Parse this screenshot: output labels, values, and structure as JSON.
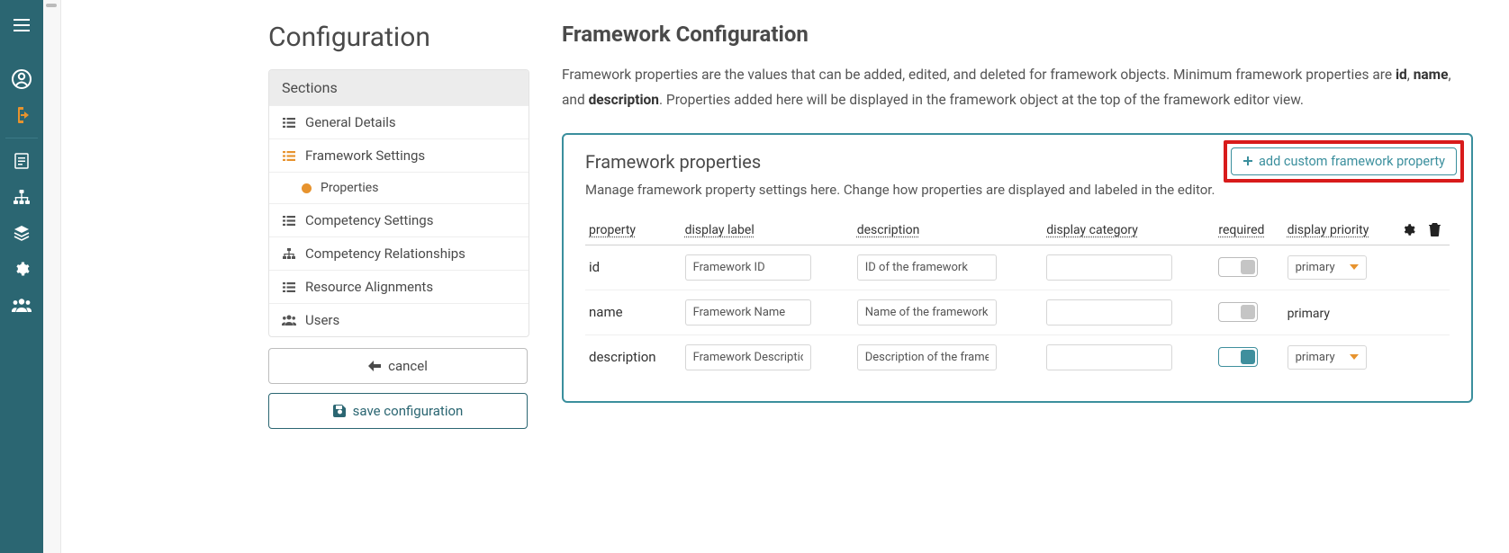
{
  "pageTitle": "Configuration",
  "sections": {
    "header": "Sections",
    "items": [
      {
        "icon": "list",
        "label": "General Details"
      },
      {
        "icon": "list",
        "label": "Framework Settings",
        "orange": true
      },
      {
        "dot": true,
        "label": "Properties",
        "sub": true
      },
      {
        "icon": "list",
        "label": "Competency Settings"
      },
      {
        "icon": "sitemap",
        "label": "Competency Relationships"
      },
      {
        "icon": "list",
        "label": "Resource Alignments"
      },
      {
        "icon": "users",
        "label": "Users"
      }
    ]
  },
  "buttons": {
    "cancel": "cancel",
    "save": "save configuration"
  },
  "right": {
    "title": "Framework Configuration",
    "desc_pre": "Framework properties are the values that can be added, edited, and deleted for framework objects. Minimum framework properties are ",
    "b1": "id",
    "c1": ", ",
    "b2": "name",
    "c2": ", and ",
    "b3": "description",
    "desc_post": ". Properties added here will be displayed in the framework object at the top of the framework editor view.",
    "panel": {
      "title": "Framework properties",
      "addLabel": "add custom framework property",
      "subtitle": "Manage framework property settings here. Change how properties are displayed and labeled in the editor.",
      "columns": {
        "property": "property",
        "label": "display label",
        "desc": "description",
        "cat": "display category",
        "req": "required",
        "prio": "display priority"
      },
      "rows": [
        {
          "prop": "id",
          "label": "Framework ID",
          "desc": "ID of the framework",
          "cat": "",
          "req": false,
          "prio": "primary",
          "prioSelect": true
        },
        {
          "prop": "name",
          "label": "Framework Name",
          "desc": "Name of the framework",
          "cat": "",
          "req": false,
          "prio": "primary",
          "prioSelect": false
        },
        {
          "prop": "description",
          "label": "Framework Description",
          "desc": "Description of the framework",
          "cat": "",
          "req": true,
          "prio": "primary",
          "prioSelect": true
        }
      ]
    }
  }
}
